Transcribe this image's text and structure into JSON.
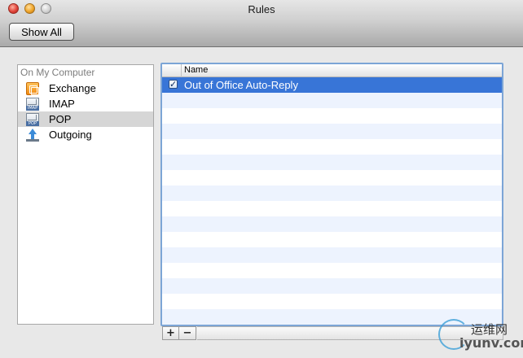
{
  "window": {
    "title": "Rules",
    "show_all_label": "Show All"
  },
  "sidebar": {
    "group_header": "On My Computer",
    "items": [
      {
        "label": "Exchange",
        "icon": "exchange-icon",
        "selected": false
      },
      {
        "label": "IMAP",
        "icon": "imap-mail-icon",
        "icon_tag": "IMAP",
        "selected": false
      },
      {
        "label": "POP",
        "icon": "pop-mail-icon",
        "icon_tag": "POP",
        "selected": true
      },
      {
        "label": "Outgoing",
        "icon": "outgoing-icon",
        "selected": false
      }
    ]
  },
  "rules_table": {
    "column_name": "Name",
    "rows": [
      {
        "name": "Out of Office Auto-Reply",
        "enabled": true,
        "checkmark": "✓",
        "selected": true
      }
    ]
  },
  "footer": {
    "add_label": "+",
    "remove_label": "−"
  },
  "watermark": {
    "cn_text": "运维网",
    "url_text": "iyunv.com"
  },
  "colors": {
    "selection": "#3875d7",
    "alt_row": "#edf3fe",
    "focus_ring": "#7ca5d6"
  }
}
